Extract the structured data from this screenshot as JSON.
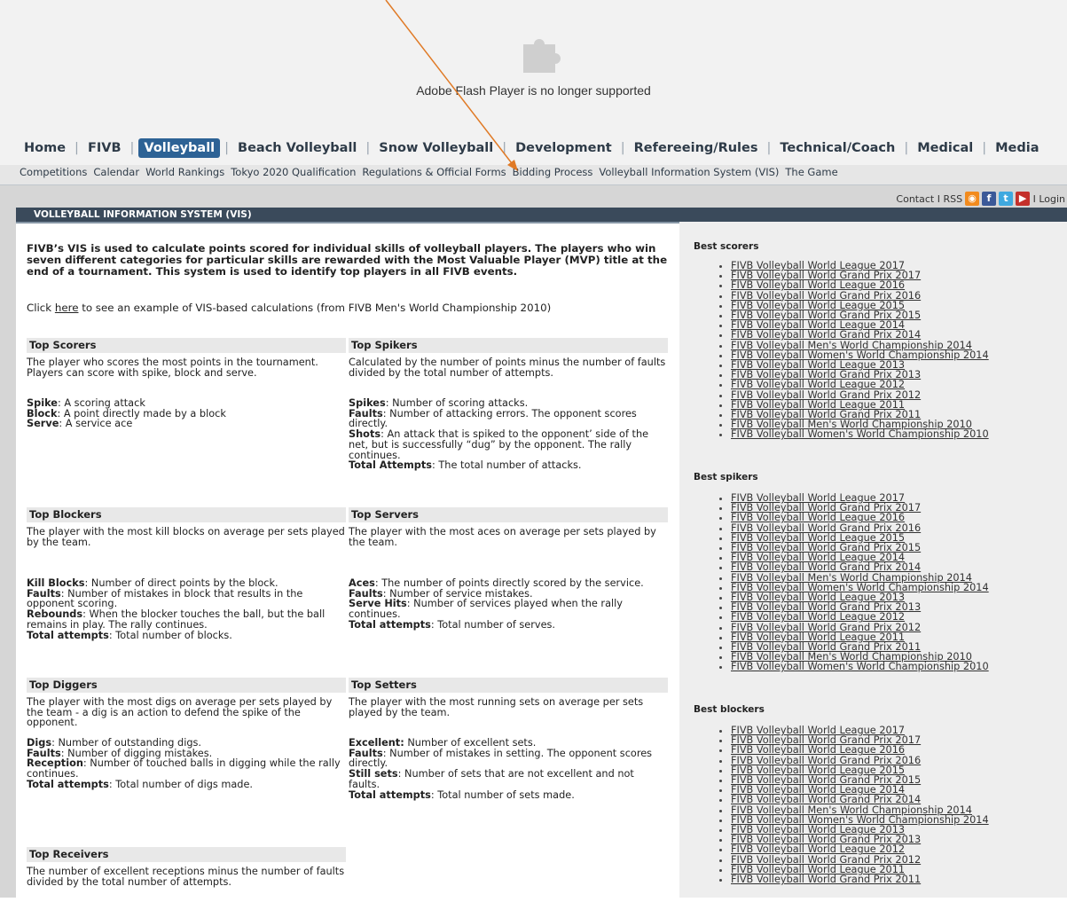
{
  "flash": {
    "message": "Adobe Flash Player is no longer supported"
  },
  "main_nav": [
    "Home",
    "FIVB",
    "Volleyball",
    "Beach Volleyball",
    "Snow Volleyball",
    "Development",
    "Refereeing/Rules",
    "Technical/Coach",
    "Medical",
    "Media"
  ],
  "main_nav_active": "Volleyball",
  "sub_nav": [
    "Competitions",
    "Calendar",
    "World Rankings",
    "Tokyo 2020 Qualification",
    "Regulations & Official Forms",
    "Bidding Process",
    "Volleyball Information System (VIS)",
    "The Game"
  ],
  "utility": {
    "contact": "Contact",
    "sep1": "I",
    "rss": "RSS",
    "sep2": "I",
    "login": "Login",
    "icons": [
      "rss-icon",
      "facebook-icon",
      "twitter-icon",
      "youtube-icon"
    ]
  },
  "panel_title": "VOLLEYBALL INFORMATION SYSTEM (VIS)",
  "intro": "FIVB’s VIS is used to calculate points scored for individual skills of volleyball players. The players who win seven different categories for particular skills are rewarded with the Most Valuable Player (MVP) title at the end of a tournament. This system is used to identify top players in all FIVB events.",
  "click": {
    "before": "Click ",
    "link": "here",
    "after": " to see an example of VIS-based calculations (from FIVB Men's World Championship 2010)"
  },
  "sections": {
    "top_scorers": {
      "title": "Top Scorers",
      "desc": "The player who scores the most points in the tournament. Players can score with spike, block and serve.",
      "items": [
        {
          "term": "Spike",
          "def": ": A scoring attack"
        },
        {
          "term": "Block",
          "def": ": A point directly made by a block"
        },
        {
          "term": "Serve",
          "def": ": A service ace"
        }
      ]
    },
    "top_spikers": {
      "title": "Top Spikers",
      "desc": "Calculated by the number of points minus the number of faults divided by the total number of attempts.",
      "items": [
        {
          "term": "Spikes",
          "def": ": Number of scoring attacks."
        },
        {
          "term": "Faults",
          "def": ": Number of attacking errors. The opponent scores directly."
        },
        {
          "term": "Shots",
          "def": ": An attack that is spiked to the opponent’ side of the net, but is successfully “dug” by the opponent. The rally continues."
        },
        {
          "term": "Total Attempts",
          "def": ": The total number of attacks."
        }
      ]
    },
    "top_blockers": {
      "title": "Top Blockers",
      "desc": "The player with the most kill blocks on average per sets played by the team.",
      "items": [
        {
          "term": "Kill Blocks",
          "def": ": Number of direct points by the block."
        },
        {
          "term": "Faults",
          "def": ": Number of mistakes in block that results in the opponent scoring."
        },
        {
          "term": "Rebounds",
          "def": ": When the blocker touches the ball, but the ball remains in play. The rally continues."
        },
        {
          "term": "Total attempts",
          "def": ": Total number of blocks."
        }
      ]
    },
    "top_servers": {
      "title": "Top Servers",
      "desc": "The player with the most aces on average per sets played by the team.",
      "items": [
        {
          "term": "Aces",
          "def": ": The number of points directly scored by the service."
        },
        {
          "term": "Faults",
          "def": ": Number of service mistakes."
        },
        {
          "term": "Serve Hits",
          "def": ": Number of services played when the rally continues."
        },
        {
          "term": "Total attempts",
          "def": ": Total number of serves."
        }
      ]
    },
    "top_diggers": {
      "title": "Top Diggers",
      "desc": "The player with the most digs on average per sets played by the team - a dig is an action to defend the spike of the opponent.",
      "items": [
        {
          "term": "Digs",
          "def": ": Number of outstanding digs."
        },
        {
          "term": "Faults",
          "def": ": Number of digging mistakes."
        },
        {
          "term": "Reception",
          "def": ": Number of touched balls in digging while the rally continues."
        },
        {
          "term": "Total attempts",
          "def": ": Total number of digs made."
        }
      ]
    },
    "top_setters": {
      "title": "Top Setters",
      "desc": "The player with the most running sets on average per sets played by the team.",
      "items": [
        {
          "term": "Excellent:",
          "def": " Number of excellent sets."
        },
        {
          "term": "Faults",
          "def": ": Number of mistakes in setting. The opponent scores directly."
        },
        {
          "term": "Still sets",
          "def": ": Number of sets that are not excellent and not faults."
        },
        {
          "term": "Total attempts",
          "def": ": Total number of sets made."
        }
      ]
    },
    "top_receivers": {
      "title": "Top Receivers",
      "desc": "The number of excellent receptions minus the number of faults divided by the total number of attempts."
    }
  },
  "sidebar": {
    "best_scorers": {
      "title": "Best scorers",
      "links": [
        "FIVB Volleyball World League 2017",
        "FIVB Volleyball World Grand Prix 2017",
        "FIVB Volleyball World League 2016",
        "FIVB Volleyball World Grand Prix 2016",
        "FIVB Volleyball World League 2015",
        "FIVB Volleyball World Grand Prix 2015",
        "FIVB Volleyball World League 2014",
        "FIVB Volleyball World Grand Prix 2014",
        "FIVB Volleyball Men's World Championship 2014",
        "FIVB Volleyball Women's World Championship 2014",
        "FIVB Volleyball World League 2013",
        "FIVB Volleyball World Grand Prix 2013",
        "FIVB Volleyball World League 2012",
        "FIVB Volleyball World Grand Prix 2012",
        "FIVB Volleyball World League 2011",
        "FIVB Volleyball World Grand Prix 2011",
        "FIVB Volleyball Men's World Championship 2010",
        "FIVB Volleyball Women's World Championship 2010"
      ]
    },
    "best_spikers": {
      "title": "Best spikers",
      "links": [
        "FIVB Volleyball World League 2017",
        "FIVB Volleyball World Grand Prix 2017",
        "FIVB Volleyball World League 2016",
        "FIVB Volleyball World Grand Prix 2016",
        "FIVB Volleyball World League 2015",
        "FIVB Volleyball World Grand Prix 2015",
        "FIVB Volleyball World League 2014",
        "FIVB Volleyball World Grand Prix 2014",
        "FIVB Volleyball Men's World Championship 2014",
        "FIVB Volleyball Women's World Championship 2014",
        "FIVB Volleyball World League 2013",
        "FIVB Volleyball World Grand Prix 2013",
        "FIVB Volleyball World League 2012",
        "FIVB Volleyball World Grand Prix 2012",
        "FIVB Volleyball World League 2011",
        "FIVB Volleyball World Grand Prix 2011",
        "FIVB Volleyball Men's World Championship 2010",
        "FIVB Volleyball Women's World Championship 2010"
      ]
    },
    "best_blockers": {
      "title": "Best blockers",
      "links": [
        "FIVB Volleyball World League 2017",
        "FIVB Volleyball World Grand Prix 2017",
        "FIVB Volleyball World League 2016",
        "FIVB Volleyball World Grand Prix 2016",
        "FIVB Volleyball World League 2015",
        "FIVB Volleyball World Grand Prix 2015",
        "FIVB Volleyball World League 2014",
        "FIVB Volleyball World Grand Prix 2014",
        "FIVB Volleyball Men's World Championship 2014",
        "FIVB Volleyball Women's World Championship 2014",
        "FIVB Volleyball World League 2013",
        "FIVB Volleyball World Grand Prix 2013",
        "FIVB Volleyball World League 2012",
        "FIVB Volleyball World Grand Prix 2012",
        "FIVB Volleyball World League 2011",
        "FIVB Volleyball World Grand Prix 2011"
      ]
    }
  },
  "colors": {
    "nav_active": "#2d6295",
    "panel_title_bg": "#3a4a5b",
    "section_header_bg": "#e8e8e8",
    "sidebar_bg": "#eeeeee",
    "annotation_arrow": "#e07a26"
  }
}
